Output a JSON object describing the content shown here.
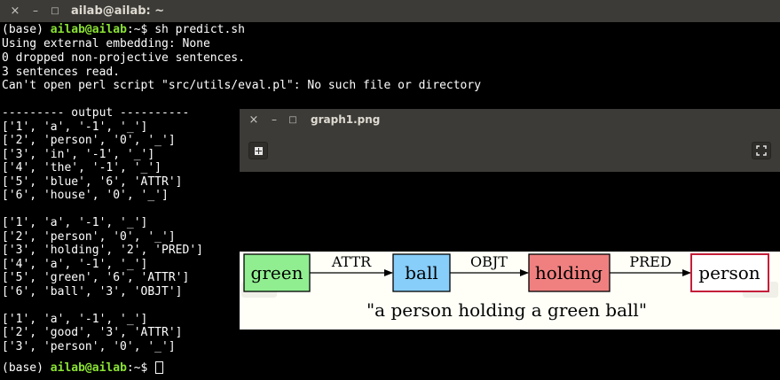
{
  "terminal": {
    "title": "ailab@ailab: ~",
    "controls": {
      "close": "×",
      "minimize": "–",
      "maximize": "□"
    },
    "prompt": {
      "env": "(base) ",
      "user_host": "ailab@ailab",
      "path": ":~",
      "symbol": "$ "
    },
    "command": "sh predict.sh",
    "output_lines": [
      "Using external embedding: None",
      "0 dropped non-projective sentences.",
      "3 sentences read.",
      "Can't open perl script \"src/utils/eval.pl\": No such file or directory",
      "",
      "--------- output ----------",
      "['1', 'a', '-1', '_']",
      "['2', 'person', '0', '_']",
      "['3', 'in', '-1', '_']",
      "['4', 'the', '-1', '_']",
      "['5', 'blue', '6', 'ATTR']",
      "['6', 'house', '0', '_']",
      "",
      "['1', 'a', '-1', '_']",
      "['2', 'person', '0', '_']",
      "['3', 'holding', '2', 'PRED']",
      "['4', 'a', '-1', '_']",
      "['5', 'green', '6', 'ATTR']",
      "['6', 'ball', '3', 'OBJT']",
      "",
      "['1', 'a', '-1', '_']",
      "['2', 'good', '3', 'ATTR']",
      "['3', 'person', '0', '_']",
      ""
    ]
  },
  "viewer": {
    "title": "graph1.png",
    "controls": {
      "close": "×",
      "minimize": "–",
      "maximize": "□"
    },
    "toolbar": {
      "add_icon": "add-icon",
      "fullscreen_icon": "fullscreen-icon"
    },
    "graph": {
      "nodes": [
        {
          "label": "green",
          "fill": "#90ee90",
          "stroke": "#000000"
        },
        {
          "label": "ball",
          "fill": "#87cefa",
          "stroke": "#000000"
        },
        {
          "label": "holding",
          "fill": "#f08080",
          "stroke": "#000000"
        },
        {
          "label": "person",
          "fill": "#ffffff",
          "stroke": "#c41e3a"
        }
      ],
      "edges": [
        {
          "label": "ATTR"
        },
        {
          "label": "OBJT"
        },
        {
          "label": "PRED"
        }
      ],
      "caption": "\"a person holding a green ball\""
    }
  },
  "colors": {
    "titlebar": "#3c3b37",
    "terminal_bg": "#000000",
    "terminal_text": "#ffffff",
    "prompt_user": "#8ae234",
    "prompt_path": "#729fcf",
    "graph_bg": "#fffff8"
  }
}
